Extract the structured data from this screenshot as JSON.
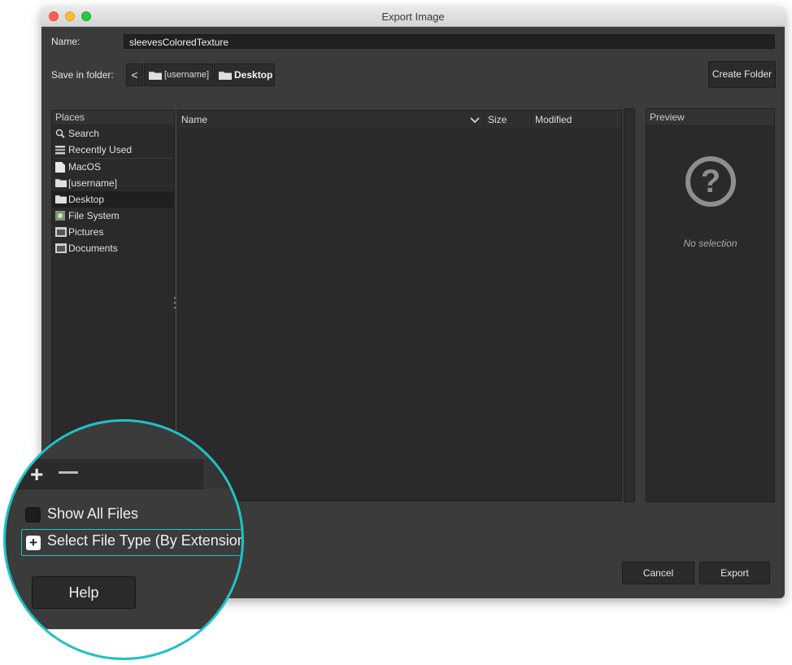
{
  "window": {
    "title": "Export Image"
  },
  "name_row": {
    "label": "Name:",
    "value": "sleevesColoredTexture"
  },
  "folder_row": {
    "label": "Save in folder:",
    "back_glyph": "<",
    "crumbs": [
      "[username]",
      "Desktop"
    ],
    "create_folder": "Create Folder"
  },
  "places": {
    "header": "Places",
    "items": [
      {
        "label": "Search",
        "icon": "search-icon"
      },
      {
        "label": "Recently Used",
        "icon": "recent-icon"
      },
      {
        "label": "MacOS",
        "icon": "drive-icon"
      },
      {
        "label": "[username]",
        "icon": "folder-icon"
      },
      {
        "label": "Desktop",
        "icon": "folder-icon"
      },
      {
        "label": "File System",
        "icon": "filesystem-icon"
      },
      {
        "label": "Pictures",
        "icon": "folder-icon"
      },
      {
        "label": "Documents",
        "icon": "folder-icon"
      }
    ]
  },
  "files": {
    "columns": {
      "name": "Name",
      "size": "Size",
      "modified": "Modified"
    }
  },
  "preview": {
    "header": "Preview",
    "glyph": "?",
    "empty": "No selection"
  },
  "buttons": {
    "cancel": "Cancel",
    "export": "Export",
    "help": "Help"
  },
  "options": {
    "show_all_files": "Show All Files",
    "select_file_type": "Select File Type (By Extension)"
  },
  "glyphs": {
    "add": "+",
    "expander": "+"
  },
  "colors": {
    "accent": "#1fc3c8",
    "window_bg": "#3b3b3b",
    "panel_bg": "#2a2a2a"
  }
}
